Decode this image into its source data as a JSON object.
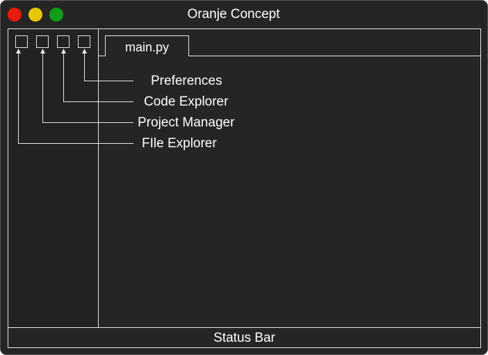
{
  "window": {
    "title": "Oranje Concept",
    "traffic_lights": [
      {
        "name": "close",
        "color": "#e51c0e"
      },
      {
        "name": "minimize",
        "color": "#e5c708"
      },
      {
        "name": "maximize",
        "color": "#109d17"
      }
    ]
  },
  "editor": {
    "tab_label": "main.py"
  },
  "callouts": [
    {
      "label": "Preferences"
    },
    {
      "label": "Code Explorer"
    },
    {
      "label": "Project Manager"
    },
    {
      "label": "FIle Explorer"
    }
  ],
  "status_bar": {
    "label": "Status Bar"
  },
  "colors": {
    "background": "#252525",
    "sidebar": "#222222",
    "lines": "#e6e6e6",
    "text": "#ffffff"
  }
}
